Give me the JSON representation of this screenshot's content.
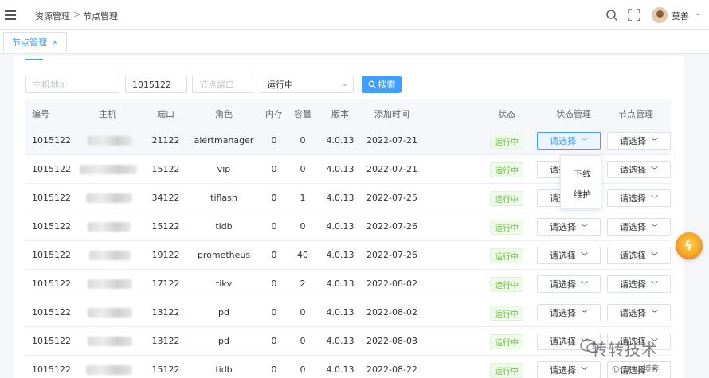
{
  "header": {
    "breadcrumb": [
      "资源管理",
      "节点管理"
    ],
    "breadcrumb_separator": ">",
    "user_name": "莫善",
    "icons": [
      "menu-icon",
      "search-icon",
      "fullscreen-icon",
      "avatar",
      "chevron-down-icon"
    ]
  },
  "tabs": [
    {
      "label": "节点管理",
      "close": "×",
      "active": true
    }
  ],
  "filters": {
    "host_placeholder": "主机地址",
    "cluster_value": "1015122",
    "port_placeholder": "节点端口",
    "status_value": "运行中",
    "search_label": "搜索"
  },
  "columns": [
    "编号",
    "主机",
    "端口",
    "角色",
    "内存",
    "容量",
    "版本",
    "添加时间",
    "状态",
    "状态管理",
    "节点管理"
  ],
  "rows": [
    {
      "id": "1015122",
      "port": "21122",
      "role": "alertmanager",
      "mem": "0",
      "cap": "0",
      "ver": "4.0.13",
      "date": "2022-07-21",
      "status": "运行中",
      "state_mgmt": "请选择",
      "node_mgmt": "请选择"
    },
    {
      "id": "1015122",
      "port": "15122",
      "role": "vip",
      "mem": "0",
      "cap": "0",
      "ver": "4.0.13",
      "date": "2022-07-21",
      "status": "运行中",
      "state_mgmt": "请选择",
      "node_mgmt": "请选择"
    },
    {
      "id": "1015122",
      "port": "34122",
      "role": "tiflash",
      "mem": "0",
      "cap": "1",
      "ver": "4.0.13",
      "date": "2022-07-25",
      "status": "运行中",
      "state_mgmt": "请选择",
      "node_mgmt": "请选择"
    },
    {
      "id": "1015122",
      "port": "15122",
      "role": "tidb",
      "mem": "0",
      "cap": "0",
      "ver": "4.0.13",
      "date": "2022-07-26",
      "status": "运行中",
      "state_mgmt": "请选择",
      "node_mgmt": "请选择"
    },
    {
      "id": "1015122",
      "port": "19122",
      "role": "prometheus",
      "mem": "0",
      "cap": "40",
      "ver": "4.0.13",
      "date": "2022-07-26",
      "status": "运行中",
      "state_mgmt": "请选择",
      "node_mgmt": "请选择"
    },
    {
      "id": "1015122",
      "port": "17122",
      "role": "tikv",
      "mem": "0",
      "cap": "2",
      "ver": "4.0.13",
      "date": "2022-08-02",
      "status": "运行中",
      "state_mgmt": "请选择",
      "node_mgmt": "请选择"
    },
    {
      "id": "1015122",
      "port": "13122",
      "role": "pd",
      "mem": "0",
      "cap": "0",
      "ver": "4.0.13",
      "date": "2022-08-02",
      "status": "运行中",
      "state_mgmt": "请选择",
      "node_mgmt": "请选择"
    },
    {
      "id": "1015122",
      "port": "13122",
      "role": "pd",
      "mem": "0",
      "cap": "0",
      "ver": "4.0.13",
      "date": "2022-08-03",
      "status": "运行中",
      "state_mgmt": "请选择",
      "node_mgmt": "请选择"
    },
    {
      "id": "1015122",
      "port": "15122",
      "role": "tidb",
      "mem": "0",
      "cap": "0",
      "ver": "4.0.13",
      "date": "2022-08-22",
      "status": "运行中",
      "state_mgmt": "请选择",
      "node_mgmt": "请选择"
    }
  ],
  "state_dropdown_options": [
    "下线",
    "维护"
  ],
  "watermark": {
    "title": "转转技术",
    "subtitle": "@ITPUB博客"
  },
  "colors": {
    "primary": "#409eff",
    "success_text": "#67c23a",
    "success_bg": "#f0f9eb",
    "header_bg": "#f5f7fa"
  }
}
